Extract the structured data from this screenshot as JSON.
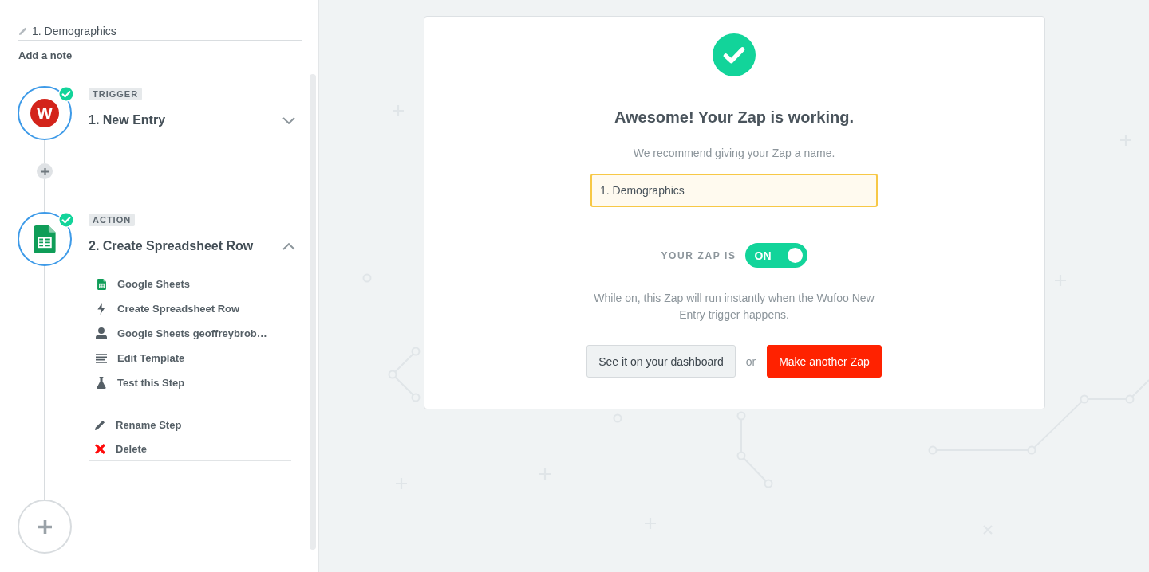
{
  "sidebar": {
    "zap_title": {
      "value": "1. Demographics"
    },
    "add_note": "Add a note",
    "steps": [
      {
        "tag": "TRIGGER",
        "title": "1. New Entry",
        "logo": {
          "kind": "letter",
          "text": "W"
        },
        "complete": true,
        "expanded": false
      },
      {
        "tag": "ACTION",
        "title": "2. Create Spreadsheet Row",
        "logo": {
          "kind": "spreadsheet"
        },
        "complete": true,
        "expanded": true,
        "details": [
          {
            "kind": "app",
            "label": "Google Sheets"
          },
          {
            "kind": "event",
            "label": "Create Spreadsheet Row"
          },
          {
            "kind": "account",
            "label": "Google Sheets geoffreybrob…"
          },
          {
            "kind": "template",
            "label": "Edit Template"
          },
          {
            "kind": "test",
            "label": "Test this Step"
          }
        ],
        "actions": [
          {
            "kind": "rename",
            "label": "Rename Step"
          },
          {
            "kind": "delete",
            "label": "Delete"
          }
        ]
      }
    ]
  },
  "main": {
    "heading": "Awesome! Your Zap is working.",
    "prompt": "We recommend giving your Zap a name.",
    "name_field": {
      "value": "1. Demographics"
    },
    "status": {
      "label": "YOUR ZAP IS",
      "toggle_text": "ON",
      "on": true
    },
    "description": "While on, this Zap will run instantly when the Wufoo New Entry trigger happens.",
    "buttons": [
      {
        "kind": "secondary",
        "label": "See it on your dashboard"
      },
      {
        "kind": "primary",
        "label": "Make another Zap"
      }
    ],
    "separator": "or"
  }
}
